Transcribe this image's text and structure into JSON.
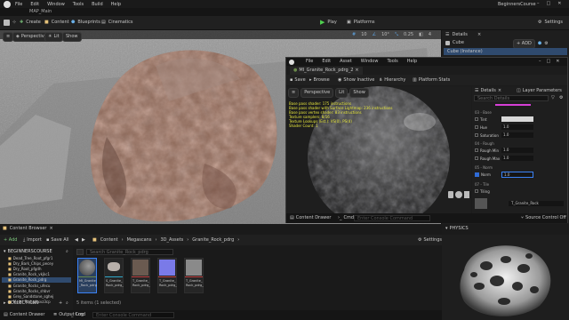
{
  "menu": {
    "items": [
      "File",
      "Edit",
      "Window",
      "Tools",
      "Build",
      "Help"
    ],
    "project": "BeginnersCourse"
  },
  "level_tab": "MAP_Main",
  "toolbar": {
    "create": "Create",
    "content": "Content",
    "blueprints": "Blueprints",
    "cinematics": "Cinematics",
    "play": "Play",
    "platforms": "Platforms",
    "settings": "Settings"
  },
  "viewport": {
    "perspective": "Perspective",
    "lit": "Lit",
    "show": "Show",
    "snap_values": [
      "10",
      "10°",
      "0.25",
      "4"
    ]
  },
  "details": {
    "tab": "Details",
    "close": "×",
    "actor": "Cube",
    "add": "+ ADD",
    "instance": "Cube (Instance)"
  },
  "material_editor": {
    "title": "MI_Granite_Rock_pdrg_2",
    "menu": [
      "File",
      "Edit",
      "Asset",
      "Window",
      "Tools",
      "Help"
    ],
    "toolbar": {
      "save": "Save",
      "browse": "Browse",
      "show_inactive": "Show Inactive",
      "hierarchy": "Hierarchy",
      "platform_stats": "Platform Stats"
    },
    "viewport": {
      "perspective": "Perspective",
      "lit": "Lit",
      "show": "Show"
    },
    "stats": [
      "Base pass shader: 175 instructions",
      "Base pass shader with Surface Lightmap: 236 instructions",
      "Base pass vertex shader: 83 instructions",
      "Texture samplers: 8/16",
      "Texture Lookups (Est.): VS(0), PS(4)",
      "Shader Count: 1"
    ],
    "panel_tabs": {
      "details": "Details",
      "layer": "Layer Parameters"
    },
    "search_placeholder": "Search Details",
    "groups": [
      {
        "label": "03 - Base",
        "rows": [
          {
            "name": "Tint",
            "value": ""
          },
          {
            "name": "Hue",
            "value": "1.0"
          },
          {
            "name": "Saturation",
            "value": "1.0"
          }
        ]
      },
      {
        "label": "04 - Rough",
        "rows": [
          {
            "name": "Rough Min",
            "value": "1.0"
          },
          {
            "name": "Rough Max",
            "value": "1.0"
          }
        ]
      },
      {
        "label": "05 - Norm",
        "rows": [
          {
            "name": "Norm",
            "value": "1.0"
          }
        ]
      },
      {
        "label": "07 - Tile",
        "rows": [
          {
            "name": "Tiling",
            "value": ""
          }
        ]
      }
    ],
    "parent_asset": "T_Granite_Rock",
    "drawer": {
      "content_drawer": "Content Drawer",
      "cmd": "Cmd",
      "console_placeholder": "Enter Console Command",
      "source_control": "Source Control Off"
    }
  },
  "content_browser": {
    "tab": "Content Browser",
    "add": "+ Add",
    "import": "Import",
    "save_all": "Save All",
    "path": [
      "Content",
      "Megascans",
      "3D_Assets",
      "Granite_Rock_pdrg"
    ],
    "settings": "Settings",
    "root": "BEGINNERSCOURSE",
    "search_placeholder": "Search Granite_Rock_pdrg",
    "tree": [
      "Dead_Tree_Root_pfgr1",
      "Dry_Bark_Chips_pecey",
      "Dry_Root_pfgdh",
      "Granite_Rock_vkjkc1",
      "Granite_Rock_pdrg",
      "Granite_Rocks_ufecu",
      "Granite_Rocks_shbvr",
      "Grey_Sandstone_sghej",
      "Metal_Rod_pbxvz3cp"
    ],
    "assets": [
      {
        "name": "MI_Granite_Rock_pdrg_2",
        "kind": "Material Instance",
        "color": "#6a8a4a"
      },
      {
        "name": "S_Granite_Rock_pdrg_LOD",
        "kind": "Static Mesh",
        "color": "#2fa8c8"
      },
      {
        "name": "T_Granite_Rock_pdrg_2K_D",
        "kind": "Texture",
        "color": "#c04040"
      },
      {
        "name": "T_Granite_Rock_pdrg_2K_N",
        "kind": "Texture",
        "color": "#c04040"
      },
      {
        "name": "T_Granite_Rock_pdrg_2K_ORM",
        "kind": "Texture",
        "color": "#c04040"
      }
    ],
    "collections": "COLLECTIONS",
    "status": "5 items (1 selected)",
    "bottom": {
      "content_drawer": "Content Drawer",
      "output_log": "Output Log",
      "cmd": "Cmd",
      "console_placeholder": "Enter Console Command"
    }
  },
  "physics": {
    "label": "PHYSICS"
  }
}
